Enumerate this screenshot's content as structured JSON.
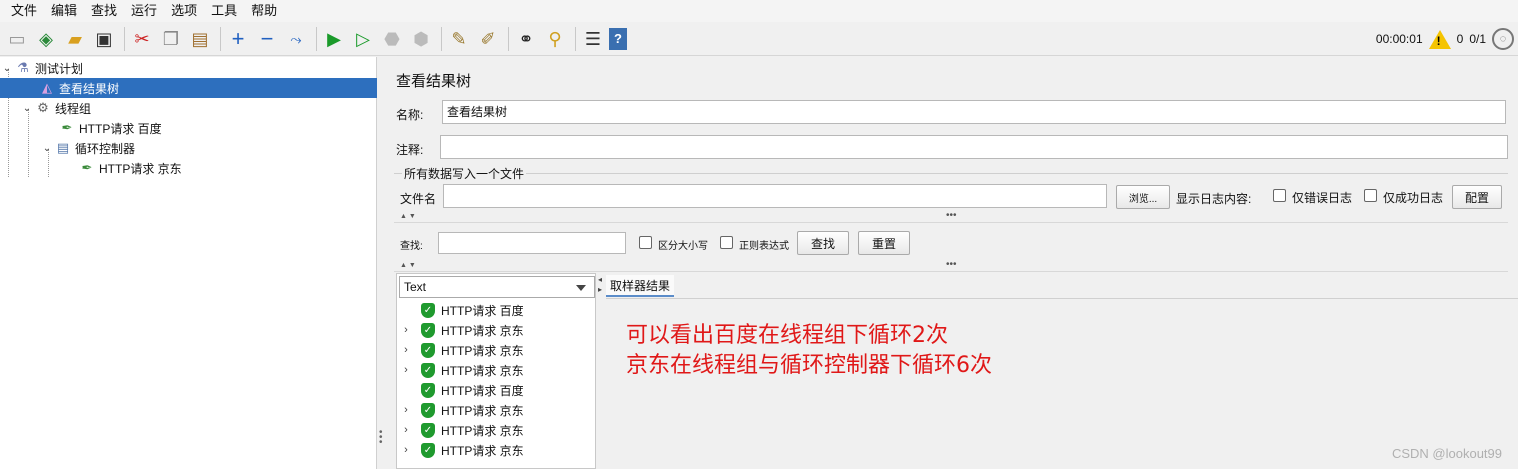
{
  "menubar": {
    "items": [
      "文件",
      "编辑",
      "查找",
      "运行",
      "选项",
      "工具",
      "帮助"
    ]
  },
  "toolbar": {
    "icons": [
      "new-icon",
      "templates-icon",
      "open-icon",
      "save-icon",
      "cut-icon",
      "copy-icon",
      "paste-icon",
      "expand-icon",
      "collapse-icon",
      "toggle-icon",
      "start-icon",
      "start-no-pause-icon",
      "stop-icon",
      "shutdown-icon",
      "clear-icon",
      "clear-all-icon",
      "search-icon",
      "reset-search-icon",
      "function-helper-icon",
      "help-icon"
    ],
    "timer": "00:00:01",
    "warnings": "0",
    "threads": "0/1"
  },
  "tree": {
    "nodes": [
      {
        "label": "测试计划"
      },
      {
        "label": "查看结果树"
      },
      {
        "label": "线程组"
      },
      {
        "label": "HTTP请求 百度"
      },
      {
        "label": "循环控制器"
      },
      {
        "label": "HTTP请求 京东"
      }
    ]
  },
  "panel": {
    "title": "查看结果树",
    "name_label": "名称:",
    "name_value": "查看结果树",
    "comment_label": "注释:",
    "comment_value": "",
    "file_section": "所有数据写入一个文件",
    "filename_label": "文件名",
    "filename_value": "",
    "browse_button": "浏览...",
    "log_label": "显示日志内容:",
    "errors_only": "仅错误日志",
    "success_only": "仅成功日志",
    "config_button": "配置",
    "search_label": "查找:",
    "search_value": "",
    "case_sensitive": "区分大小写",
    "regex": "正则表达式",
    "find_button": "查找",
    "reset_button": "重置"
  },
  "results": {
    "renderer": "Text",
    "rows": [
      {
        "label": "HTTP请求 百度",
        "expandable": false
      },
      {
        "label": "HTTP请求 京东",
        "expandable": true
      },
      {
        "label": "HTTP请求 京东",
        "expandable": true
      },
      {
        "label": "HTTP请求 京东",
        "expandable": true
      },
      {
        "label": "HTTP请求 百度",
        "expandable": false
      },
      {
        "label": "HTTP请求 京东",
        "expandable": true
      },
      {
        "label": "HTTP请求 京东",
        "expandable": true
      },
      {
        "label": "HTTP请求 京东",
        "expandable": true
      }
    ],
    "tab": "取样器结果",
    "annotation_line1": "可以看出百度在线程组下循环2次",
    "annotation_line2": "京东在线程组与循环控制器下循环6次"
  },
  "watermark": "CSDN @lookout99",
  "colors": {
    "selection": "#2d6fbe",
    "annotation": "#e01818",
    "success": "#1f9a2e"
  }
}
